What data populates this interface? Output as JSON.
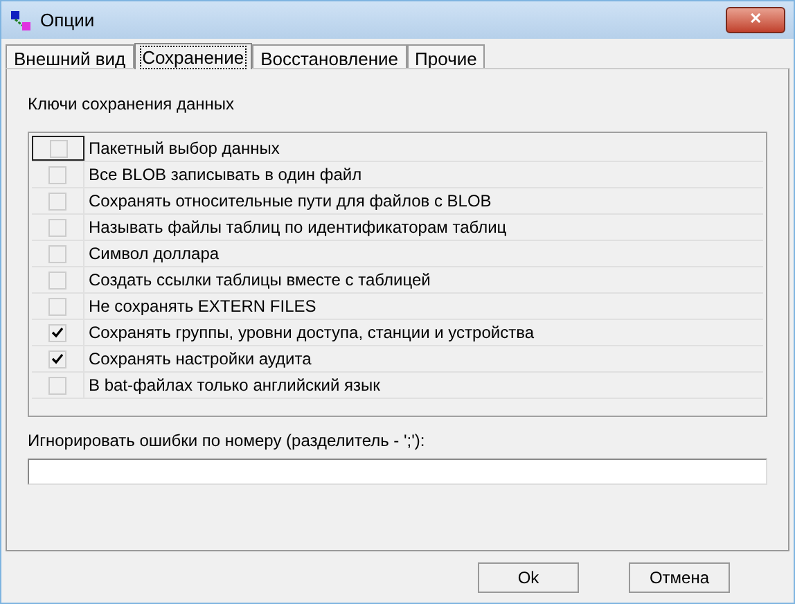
{
  "window": {
    "title": "Опции",
    "close": "✕"
  },
  "tabs": [
    {
      "label": "Внешний вид",
      "selected": false
    },
    {
      "label": "Сохранение",
      "selected": true
    },
    {
      "label": "Восстановление",
      "selected": false
    },
    {
      "label": "Прочие",
      "selected": false
    }
  ],
  "group_label": "Ключи сохранения данных",
  "options": [
    {
      "label": "Пакетный выбор данных",
      "checked": false,
      "focused": true
    },
    {
      "label": "Все BLOB записывать в один файл",
      "checked": false,
      "focused": false
    },
    {
      "label": "Сохранять относительные пути для файлов с BLOB",
      "checked": false,
      "focused": false
    },
    {
      "label": "Называть файлы таблиц по идентификаторам таблиц",
      "checked": false,
      "focused": false
    },
    {
      "label": "Символ доллара",
      "checked": false,
      "focused": false
    },
    {
      "label": "Создать ссылки таблицы вместе с таблицей",
      "checked": false,
      "focused": false
    },
    {
      "label": "Не сохранять EXTERN FILES",
      "checked": false,
      "focused": false
    },
    {
      "label": "Сохранять группы, уровни доступа, станции и устройства",
      "checked": true,
      "focused": false
    },
    {
      "label": "Сохранять настройки аудита",
      "checked": true,
      "focused": false
    },
    {
      "label": "В bat-файлах только английский язык",
      "checked": false,
      "focused": false
    }
  ],
  "ignore_errors": {
    "label": "Игнорировать ошибки по номеру (разделитель - ';'):"
  },
  "buttons": [
    "Ok",
    "Отмена"
  ]
}
